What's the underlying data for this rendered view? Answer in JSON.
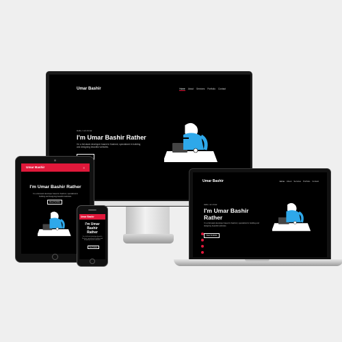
{
  "colors": {
    "accent": "#e0183a",
    "screen_bg": "#000000",
    "hair": "#2ea8ea",
    "page_bg": "#efefef"
  },
  "site": {
    "logo": "Umar Bashir",
    "nav": [
      "Home",
      "About",
      "Services",
      "Portfolio",
      "Contact"
    ],
    "eyebrow": "Hello, I am Umar",
    "title": "I'm Umar Bashir Rather",
    "title_line1": "I'm Umar Bashir",
    "title_line2": "Rather",
    "description": "I'm a full-stack developer based in Kashmir, specialized in building and designing beautiful websites.",
    "button": "View Portfolio"
  },
  "icons": {
    "menu": "hamburger-icon",
    "illustration": "developer-at-laptop-illustration",
    "social": [
      "instagram-icon",
      "twitter-icon",
      "github-icon",
      "linkedin-icon"
    ]
  }
}
